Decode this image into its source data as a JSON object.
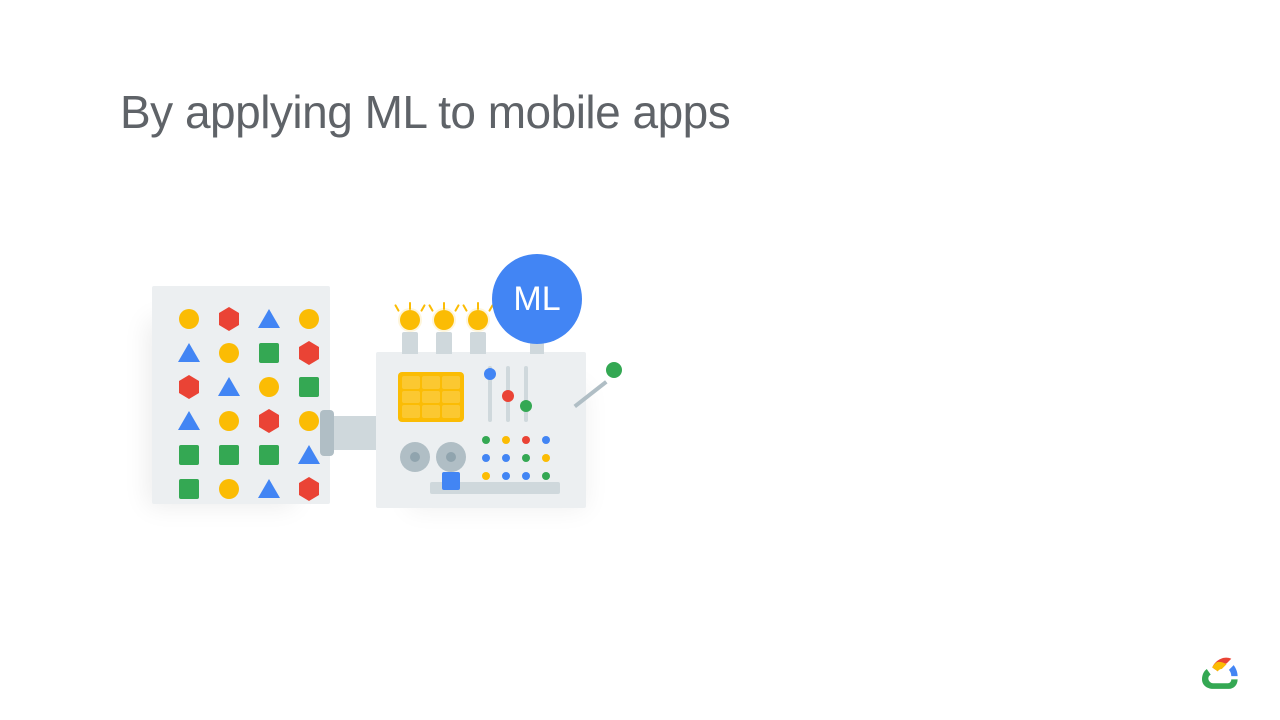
{
  "title": "By applying ML to mobile apps",
  "badge": {
    "label": "ML"
  },
  "colors": {
    "blue": "#4285f4",
    "red": "#ea4335",
    "yellow": "#fbbc04",
    "green": "#34a853",
    "grey": "#5f6368"
  },
  "data_panel_grid": [
    [
      "circle:yellow",
      "hex:red",
      "triangle:blue",
      "circle:yellow"
    ],
    [
      "triangle:blue",
      "circle:yellow",
      "square:green",
      "hex:red"
    ],
    [
      "hex:red",
      "triangle:blue",
      "circle:yellow",
      "square:green"
    ],
    [
      "triangle:blue",
      "circle:yellow",
      "hex:red",
      "circle:yellow"
    ],
    [
      "square:green",
      "square:green",
      "square:green",
      "triangle:blue"
    ],
    [
      "square:green",
      "circle:yellow",
      "triangle:blue",
      "hex:red"
    ]
  ],
  "machine": {
    "bulb_count": 3,
    "sliders": [
      {
        "color": "blue",
        "pos": "top"
      },
      {
        "color": "red",
        "pos": "mid"
      },
      {
        "color": "green",
        "pos": "low"
      }
    ],
    "dot_matrix": [
      [
        "green",
        "yellow",
        "red",
        "blue"
      ],
      [
        "blue",
        "blue",
        "green",
        "yellow"
      ],
      [
        "yellow",
        "blue",
        "blue",
        "green"
      ]
    ],
    "lever_color": "green",
    "tray_cube_color": "blue"
  },
  "brand": "Google Cloud"
}
